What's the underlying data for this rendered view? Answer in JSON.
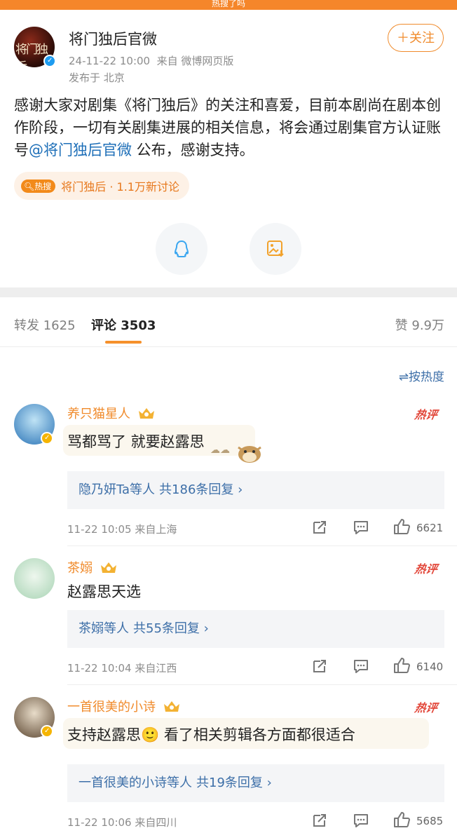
{
  "topbar": {
    "title": "热搜了吗"
  },
  "post": {
    "author": "将门独后官微",
    "avatar_text": "将门独后",
    "time_source": "24-11-22 10:00",
    "source": "来自 微博网页版",
    "location": "发布于 北京",
    "follow_label": "＋关注",
    "text_before": "感谢大家对剧集《将门独后》的关注和喜爱，目前本剧尚在剧本创作阶段，一切有关剧集进展的相关信息，将会通过剧集官方认证账号",
    "mention": "@将门独后官微",
    "text_after": " 公布，感谢支持。",
    "hot_badge": "热搜",
    "hot_text": "将门独后 · 1.1万新讨论",
    "actions": [
      {
        "icon": "qq-icon"
      },
      {
        "icon": "save-image-icon"
      }
    ]
  },
  "tabs": {
    "repost": "转发 1625",
    "comment": "评论 3503",
    "like": "赞 9.9万"
  },
  "sort_label": "按热度",
  "comments": [
    {
      "name": "养只猫星人",
      "hot": "热评",
      "text": "骂都骂了 就要赵露思",
      "reply": "隐乃妍Ta等人",
      "reply_count": "共186条回复 ›",
      "time": "11-22 10:05",
      "source": "来自上海",
      "likes": "6621"
    },
    {
      "name": "茶嫋",
      "hot": "热评",
      "text": "赵露思天选",
      "reply": "茶嫋等人",
      "reply_count": "共55条回复 ›",
      "time": "11-22 10:04",
      "source": "来自江西",
      "likes": "6140"
    },
    {
      "name": "一首很美的小诗",
      "hot": "热评",
      "text": "支持赵露思🙂 看了相关剪辑各方面都很适合",
      "reply": "一首很美的小诗等人",
      "reply_count": "共19条回复 ›",
      "time": "11-22 10:06",
      "source": "来自四川",
      "likes": "5685"
    }
  ],
  "colors": {
    "accent": "#f08b2c",
    "link": "#3d6fa8",
    "hot": "#e2473a"
  }
}
